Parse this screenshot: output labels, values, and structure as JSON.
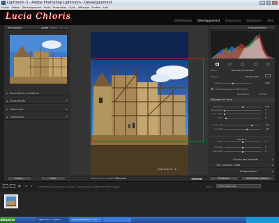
{
  "window": {
    "title": "Lightroom 3 - Adobe Photoshop Lightroom - Développement"
  },
  "menu": [
    "Fichier",
    "Edition",
    "Développement",
    "Photo",
    "Paramètres",
    "Outils",
    "Affichage",
    "Fenêtre",
    "Aide"
  ],
  "identity_plate": "Lucia Chloris",
  "modules": [
    "Bibliothèque",
    "Développement",
    "Diaporama",
    "Impression",
    "Web"
  ],
  "active_module": "Développement",
  "navigator": {
    "title": "Navigateur",
    "options": [
      "ADAPT",
      "REMPL",
      "1:1",
      "2:1"
    ]
  },
  "left_sections": [
    {
      "label": "Paramètres prédéfinis",
      "plus": ""
    },
    {
      "label": "Instantanés",
      "plus": "+"
    },
    {
      "label": "Historique",
      "plus": "×"
    },
    {
      "label": "Collections",
      "plus": "+"
    }
  ],
  "left_buttons": {
    "copy": "Copier...",
    "paste": "Coller"
  },
  "watermark": "Valentin N. ©",
  "toolbar": {
    "crop_style_label": "Style de l'incrustation :",
    "crop_style_value": "Tiquesse",
    "done": "Terminé"
  },
  "histogram": {
    "title": "Histogramme"
  },
  "crop": {
    "tool_label": "Outil :",
    "tool_value": "Recadrer et redresser",
    "aspect_label": "Aspect :",
    "aspect_value": "Personnalisé",
    "angle_label": "Angle :",
    "angle_value": "0,00",
    "constrain_label": "Contrainte jusqu'à déformation",
    "reset": "Réinitialiser",
    "close": "Fermer"
  },
  "basic": {
    "title": "Réglages de base",
    "sliders": [
      {
        "label": "Exposition",
        "value": "0,00",
        "pos": 0.5
      },
      {
        "label": "Récupération",
        "value": "0",
        "pos": 0.0
      },
      {
        "label": "Lum. d'app.",
        "value": "0",
        "pos": 0.0
      },
      {
        "label": "Noirs",
        "value": "5",
        "pos": 0.05
      },
      {
        "label": "Luminosité",
        "value": "+50",
        "pos": 0.75
      },
      {
        "label": "Contraste",
        "value": "+25",
        "pos": 0.62
      },
      {
        "label": "Clarté",
        "value": "0",
        "pos": 0.5
      },
      {
        "label": "Vibrance",
        "value": "0",
        "pos": 0.5
      },
      {
        "label": "Saturation",
        "value": "0",
        "pos": 0.5
      }
    ],
    "presence": "Présence"
  },
  "right_sections": [
    "Courbe des tonalités",
    "TSL / Couleur / N&B",
    "Virage partiel"
  ],
  "right_buttons": {
    "previous": "Précédent",
    "reset": "Réinitialiser (Adobe)"
  },
  "status": {
    "source": "Importation précédente / 1 photo / 1 sélectionnée / Château Portrait 12.jpeg",
    "filter_label": "Filtre :",
    "filter_value": "Filtres désactivés"
  },
  "taskbar": {
    "start": "démarrer",
    "tasks": [
      "Lightroom 3 - Adobe...",
      "Forum-RebelFest.fr • Co...",
      ""
    ],
    "tray": ""
  },
  "colors": {
    "crop_border": "#e11",
    "accent": "#e33"
  }
}
